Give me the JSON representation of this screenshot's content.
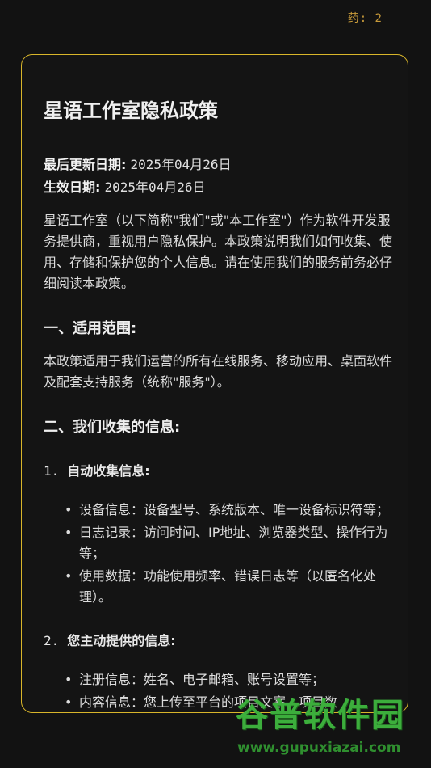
{
  "topbar": {
    "text": "药: 2"
  },
  "policy": {
    "title": "星语工作室隐私政策",
    "updated_label": "最后更新日期:",
    "updated_value": "2025年04月26日",
    "effective_label": "生效日期:",
    "effective_value": "2025年04月26日",
    "intro": "星语工作室（以下简称\"我们\"或\"本工作室\"）作为软件开发服务提供商，重视用户隐私保护。本政策说明我们如何收集、使用、存储和保护您的个人信息。请在使用我们的服务前务必仔细阅读本政策。",
    "section1_title": "一、适用范围:",
    "section1_text": "本政策适用于我们运营的所有在线服务、移动应用、桌面软件及配套支持服务（统称\"服务\"）。",
    "section2_title": "二、我们收集的信息:",
    "sub1_num": "1.",
    "sub1_title": "自动收集信息:",
    "sub1_items": [
      "设备信息：设备型号、系统版本、唯一设备标识符等；",
      "日志记录：访问时间、IP地址、浏览器类型、操作行为等；",
      "使用数据：功能使用频率、错误日志等（以匿名化处理）。"
    ],
    "sub2_num": "2.",
    "sub2_title": "您主动提供的信息:",
    "sub2_items": [
      "注册信息：姓名、电子邮箱、账号设置等；",
      "内容信息：您上传至平台的项目文案、项目数"
    ]
  },
  "watermark": {
    "logo": "谷普软件园",
    "url": "www.gupuxiazai.com"
  },
  "colors": {
    "accent": "#d8b52a",
    "topbar": "#c79a3a",
    "watermark": "#3cae3c"
  }
}
